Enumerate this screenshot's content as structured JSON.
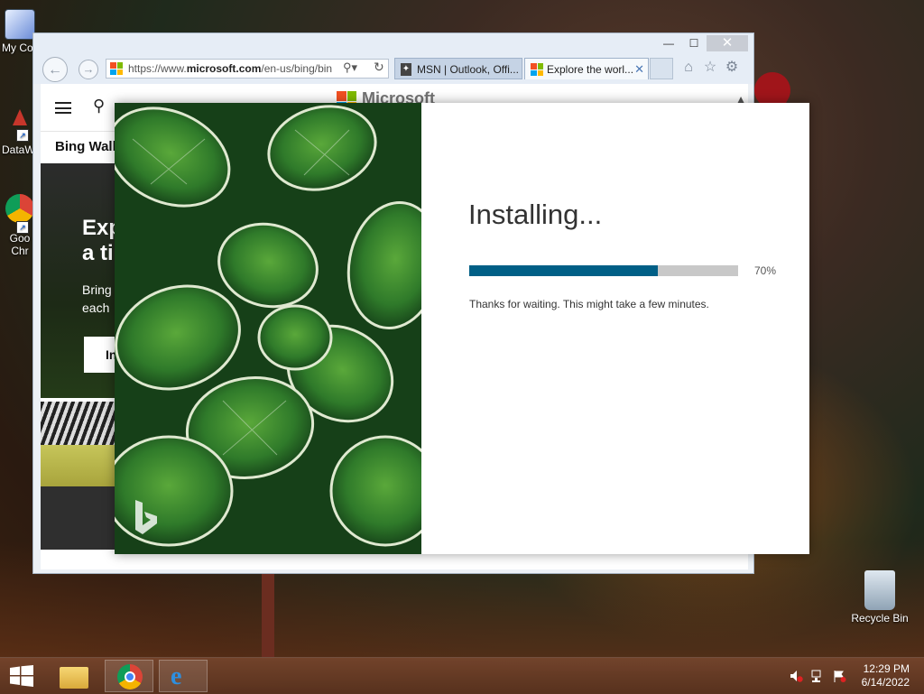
{
  "desktop": {
    "icons": [
      {
        "name": "my-computer",
        "label": "My Co"
      },
      {
        "name": "datawrangler",
        "label": "DataW"
      },
      {
        "name": "google-chrome",
        "label": "Goo\nChr"
      },
      {
        "name": "recycle-bin",
        "label": "Recycle Bin"
      }
    ]
  },
  "browser": {
    "address": "https://www.microsoft.com/en-us/bing/bin",
    "address_domain": "microsoft.com",
    "address_prefix": "https://www.",
    "address_suffix": "/en-us/bing/bin",
    "tabs": [
      {
        "label": "MSN | Outlook, Offi..."
      },
      {
        "label": "Explore the worl..."
      }
    ],
    "window_buttons": {
      "minimize": "—",
      "maximize": "☐",
      "close": "✕"
    },
    "page": {
      "brand": "Microsoft",
      "section_title": "Bing Wallpaper",
      "hero_title": "Explore a ti",
      "hero_title_line1": "Exp",
      "hero_title_line2": "a ti",
      "hero_sub_line1": "Bring",
      "hero_sub_line2": "each",
      "hero_button": "In"
    }
  },
  "installer": {
    "title": "Installing...",
    "progress": 70,
    "progress_label": "70%",
    "message": "Thanks for waiting. This might take a few minutes.",
    "accent": "#005f86"
  },
  "taskbar": {
    "time": "12:29 PM",
    "date": "6/14/2022"
  }
}
